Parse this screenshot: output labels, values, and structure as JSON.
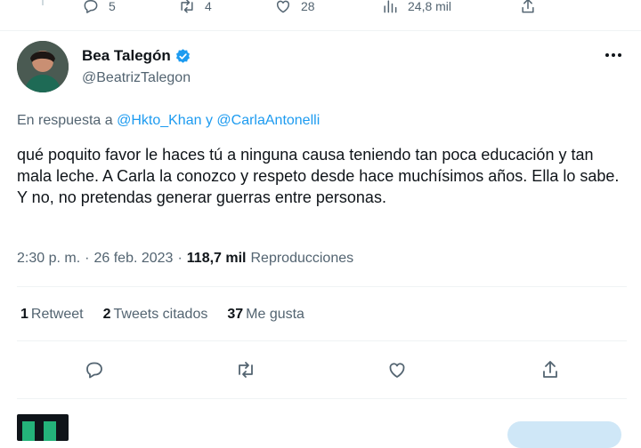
{
  "previous_tweet": {
    "replies": "5",
    "retweets": "4",
    "likes": "28",
    "views": "24,8 mil"
  },
  "author": {
    "name": "Bea Talegón",
    "handle": "@BeatrizTalegon",
    "verified": true
  },
  "reply_to": {
    "prefix": "En respuesta a",
    "user1": "@Hkto_Khan",
    "joiner": "y",
    "user2": "@CarlaAntonelli"
  },
  "tweet": {
    "text": "qué poquito favor le haces tú a ninguna causa teniendo tan poca educación y tan mala leche. A Carla la conozco y respeto desde hace muchísimos años. Ella lo sabe. Y no, no pretendas generar guerras entre personas.",
    "time": "2:30 p. m.",
    "separator": "·",
    "date": "26 feb. 2023",
    "separator2": "·",
    "views_count": "118,7 mil",
    "views_label": "Reproducciones"
  },
  "stats": {
    "retweets_count": "1",
    "retweets_label": "Retweet",
    "quotes_count": "2",
    "quotes_label": "Tweets citados",
    "likes_count": "37",
    "likes_label": "Me gusta"
  },
  "colors": {
    "accent": "#1d9bf0",
    "muted_text": "#536471",
    "text": "#0f1419",
    "divider": "#eff3f4"
  },
  "icons": [
    "reply-icon",
    "retweet-icon",
    "like-icon",
    "views-icon",
    "share-icon",
    "verified-badge-icon",
    "more-icon"
  ]
}
